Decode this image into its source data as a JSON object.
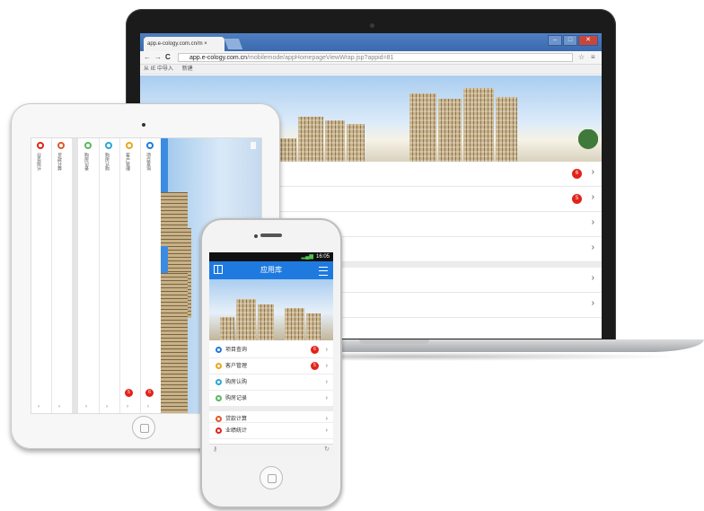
{
  "colors": {
    "accent": "#1f7ae0",
    "badge": "#e2231a",
    "dot_colors": [
      "#1f7ae0",
      "#e6a817",
      "#2aa6d8",
      "#5cb85c",
      "#e0582a",
      "#e2231a"
    ]
  },
  "laptop": {
    "tab_title": "app.e-cology.com.cn/m ×",
    "url_host": "app.e-cology.com.cn",
    "url_path": "/mobilemode/appHomepageViewWrap.jsp?appid=81",
    "bookmarks": [
      "从 IE 中导入",
      "新建"
    ],
    "rows": [
      {
        "badge": "6",
        "chevron": "›"
      },
      {
        "badge": "5",
        "chevron": "›"
      },
      {
        "badge": "",
        "chevron": "›"
      },
      {
        "badge": "",
        "chevron": "›"
      },
      {
        "badge": "",
        "chevron": "›"
      },
      {
        "badge": "",
        "chevron": "›"
      }
    ]
  },
  "tablet": {
    "columns": [
      {
        "label": "业务统计",
        "color": "#e2231a",
        "badge": ""
      },
      {
        "label": "贷款计算",
        "color": "#e0582a",
        "badge": ""
      },
      {
        "label": "购房记录",
        "color": "#5cb85c",
        "badge": ""
      },
      {
        "label": "购房认购",
        "color": "#2aa6d8",
        "badge": ""
      },
      {
        "label": "客户管理",
        "color": "#e6a817",
        "badge": "5"
      },
      {
        "label": "项目查询",
        "color": "#1f7ae0",
        "badge": "6"
      }
    ],
    "chevron": "›"
  },
  "phone": {
    "status_time": "16:05",
    "title": "应用库",
    "rows": [
      {
        "label": "项目查询",
        "color": "#1f7ae0",
        "badge": "6",
        "chevron": "›"
      },
      {
        "label": "客户管理",
        "color": "#e6a817",
        "badge": "5",
        "chevron": "›"
      },
      {
        "label": "购房认购",
        "color": "#2aa6d8",
        "badge": "",
        "chevron": "›"
      },
      {
        "label": "购房记录",
        "color": "#5cb85c",
        "badge": "",
        "chevron": "›"
      },
      {
        "label": "贷款计算",
        "color": "#e0582a",
        "badge": "",
        "chevron": "›"
      },
      {
        "label": "业绩统计",
        "color": "#e2231a",
        "badge": "",
        "chevron": "›"
      }
    ]
  }
}
